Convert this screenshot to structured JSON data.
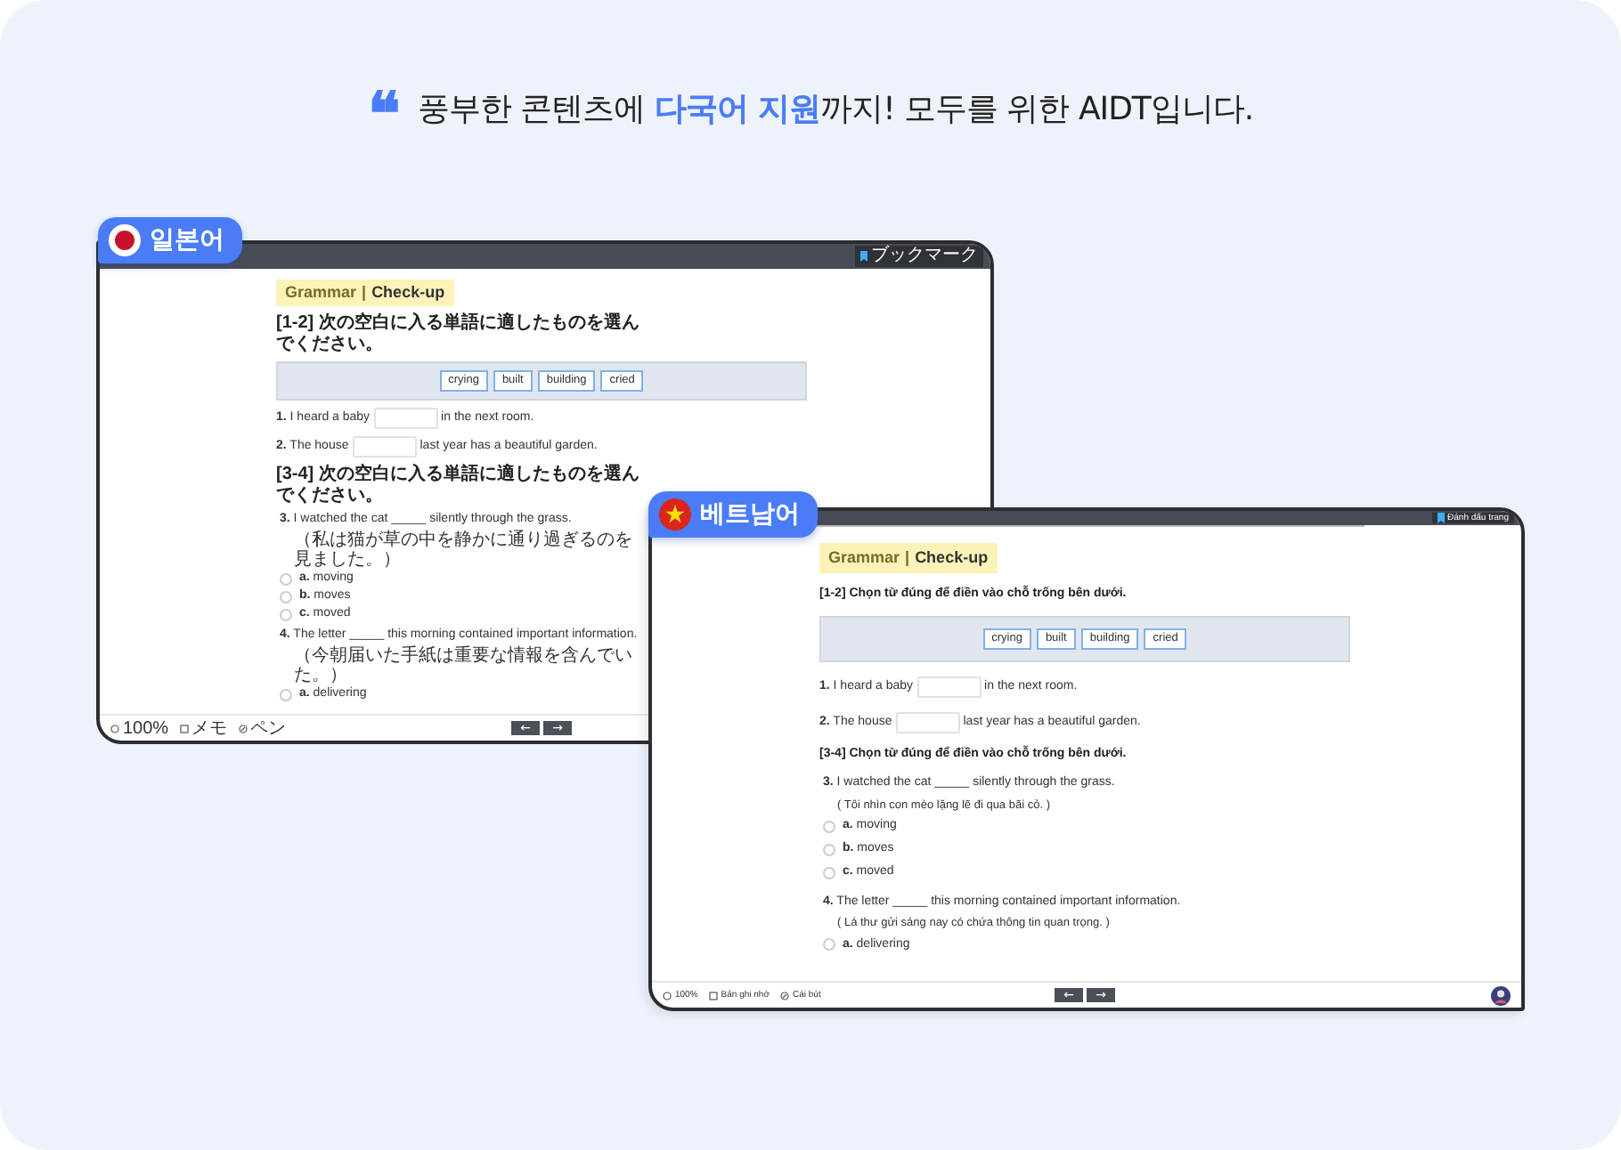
{
  "headline": {
    "quote_mark": "❝",
    "text": "풍부한 콘텐츠에 **다국어 지원**까지! 모두를 위한 AIDT입니다."
  },
  "windows": [
    {
      "language": "일본어",
      "kind": "japan",
      "bookmark": "ブックマーク",
      "subject": "Grammar",
      "separator": "|",
      "heading": "Check-up",
      "instruction_1": "[1-2] 次の空白に入る単語に適したものを選んでください。",
      "word_bank": [
        "crying",
        "built",
        "building",
        "cried"
      ],
      "blanks": [
        {
          "number": "1.",
          "before": "I heard a baby",
          "after": "in the next room."
        },
        {
          "number": "2.",
          "before": "The house",
          "after": "last year has a beautiful garden."
        }
      ],
      "instruction_2": "[3-4] 次の空白に入る単語に適したものを選んでください。",
      "questions": [
        {
          "number": "3.",
          "text": "I watched the cat _____ silently through the grass.",
          "translation": "（私は猫が草の中を静かに通り過ぎるのを見ました。）",
          "options": [
            {
              "letter": "a.",
              "text": "moving",
              "selected": false
            },
            {
              "letter": "b.",
              "text": "moves",
              "selected": false
            },
            {
              "letter": "c.",
              "text": "moved",
              "selected": false
            }
          ]
        },
        {
          "number": "4.",
          "text": "The letter _____ this morning contained important information.",
          "translation": "（今朝届いた手紙は重要な情報を含んでいた。）",
          "options": [
            {
              "letter": "a.",
              "text": "delivering",
              "selected": false
            }
          ]
        }
      ],
      "toolbar": {
        "zoom": "100%",
        "memo": "メモ",
        "pen": "ペン"
      },
      "nav": [
        "←",
        "→"
      ]
    },
    {
      "language": "베트남어",
      "kind": "vietnam",
      "bookmark": "Đánh dấu trang",
      "subject": "Grammar",
      "separator": "|",
      "heading": "Check-up",
      "instruction_1": "[1-2] Chọn từ đúng để điền vào chỗ trống bên dưới.",
      "word_bank": [
        "crying",
        "built",
        "building",
        "cried"
      ],
      "blanks": [
        {
          "number": "1.",
          "before": "I heard a baby",
          "after": "in the next room."
        },
        {
          "number": "2.",
          "before": "The house",
          "after": "last year has a beautiful garden."
        }
      ],
      "instruction_2": "[3-4] Chọn từ đúng để điền vào chỗ trống bên dưới.",
      "questions": [
        {
          "number": "3.",
          "text": "I watched the cat _____ silently through the grass.",
          "translation": "( Tôi nhìn con mèo lặng lẽ đi qua bãi cỏ. )",
          "options": [
            {
              "letter": "a.",
              "text": "moving",
              "selected": false
            },
            {
              "letter": "b.",
              "text": "moves",
              "selected": false
            },
            {
              "letter": "c.",
              "text": "moved",
              "selected": false
            }
          ]
        },
        {
          "number": "4.",
          "text": "The letter _____ this morning contained important information.",
          "translation": "( Lá thư gửi sáng nay có chứa thông tin quan trọng. )",
          "options": [
            {
              "letter": "a.",
              "text": "delivering",
              "selected": false
            }
          ]
        }
      ],
      "toolbar": {
        "zoom": "100%",
        "memo": "Bản ghi nhớ",
        "pen": "Cái bút"
      },
      "nav": [
        "←",
        "→"
      ],
      "avatar": true
    }
  ]
}
